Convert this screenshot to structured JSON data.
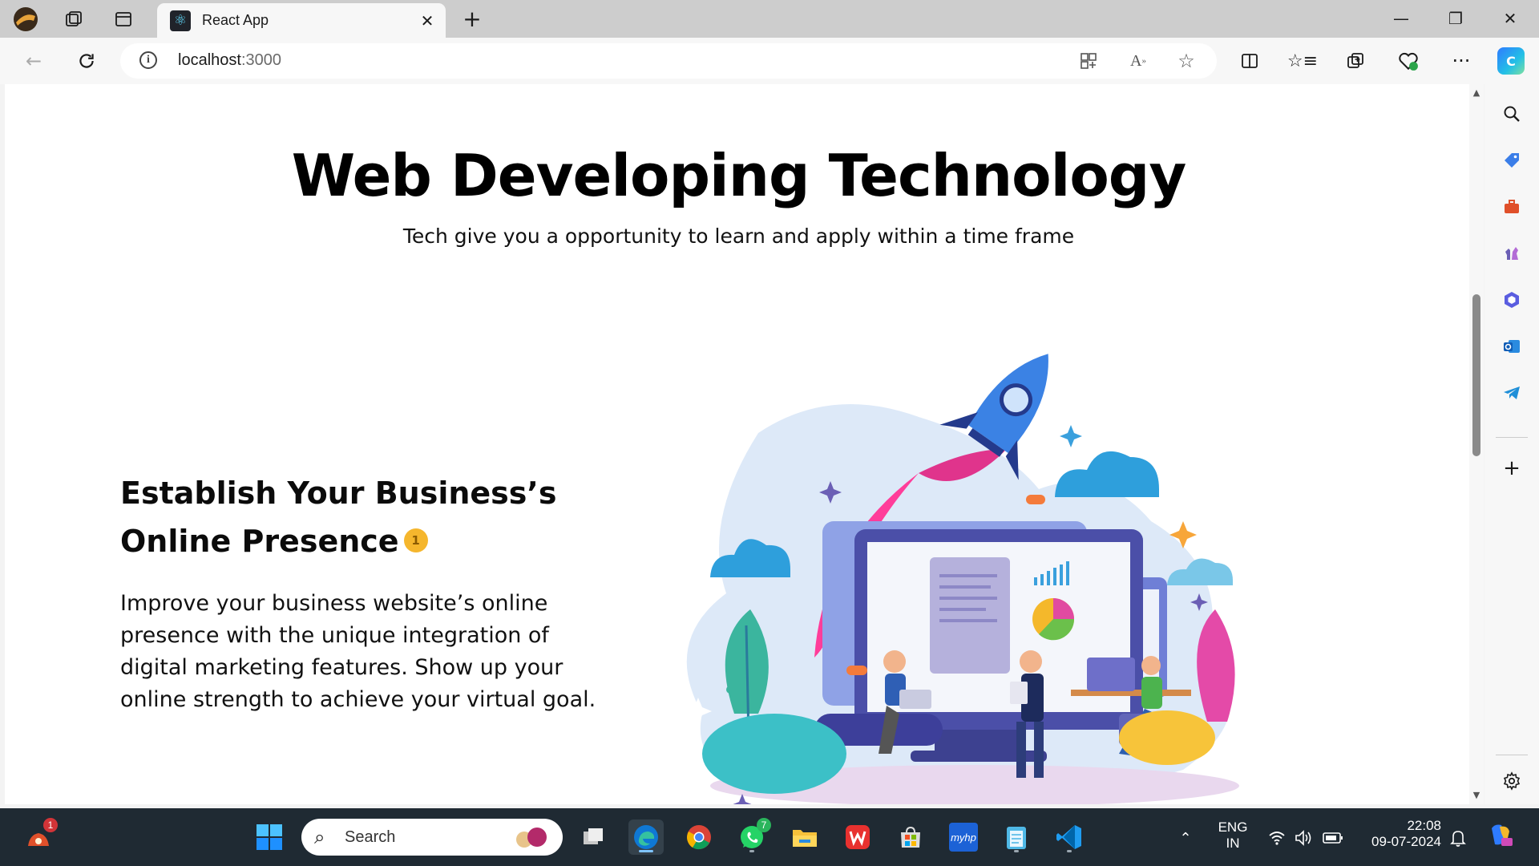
{
  "browser": {
    "tab": {
      "title": "React App",
      "favicon": "react-logo-icon",
      "close": "✕"
    },
    "new_tab": "+",
    "window_controls": {
      "minimize": "—",
      "restore": "❐",
      "close": "✕"
    },
    "address": {
      "host": "localhost",
      "port": ":3000"
    },
    "icons": [
      "back-icon",
      "refresh-icon",
      "site-info-icon",
      "app-available-icon",
      "read-aloud-icon",
      "favorite-star-icon",
      "split-screen-icon",
      "favorites-icon",
      "collections-icon",
      "browser-essentials-icon",
      "more-icon",
      "copilot-icon"
    ]
  },
  "page": {
    "title": "Web Developing Technology",
    "subtitle": "Tech give you a opportunity to learn and apply within a time frame",
    "hero": {
      "heading_line1": "Establish Your Business’s",
      "heading_line2": "Online Presence",
      "heading_emoji": "1",
      "text": "Improve your business website’s online presence with the unique integration of digital marketing features. Show up your online strength to achieve your virtual goal."
    }
  },
  "sidebar": {
    "icons": [
      "search-icon",
      "shopping-tag-icon",
      "tools-icon",
      "games-icon",
      "microsoft-365-icon",
      "outlook-icon",
      "telegram-icon",
      "add-icon",
      "settings-icon"
    ]
  },
  "taskbar": {
    "search_placeholder": "Search",
    "weather_badge": "1",
    "whatsapp_badge": "7",
    "language_line1": "ENG",
    "language_line2": "IN",
    "time": "22:08",
    "date": "09-07-2024",
    "apps": [
      "start-icon",
      "task-view-icon",
      "edge-icon",
      "chrome-icon",
      "whatsapp-icon",
      "file-explorer-icon",
      "wps-office-icon",
      "microsoft-store-icon",
      "myhp-icon",
      "notepad-icon",
      "vscode-icon"
    ],
    "myhp_label": "myhp"
  },
  "colors": {
    "accent_edge": "#0f78d4",
    "title_text": "#000000",
    "taskbar_bg": "#1f2a33"
  }
}
